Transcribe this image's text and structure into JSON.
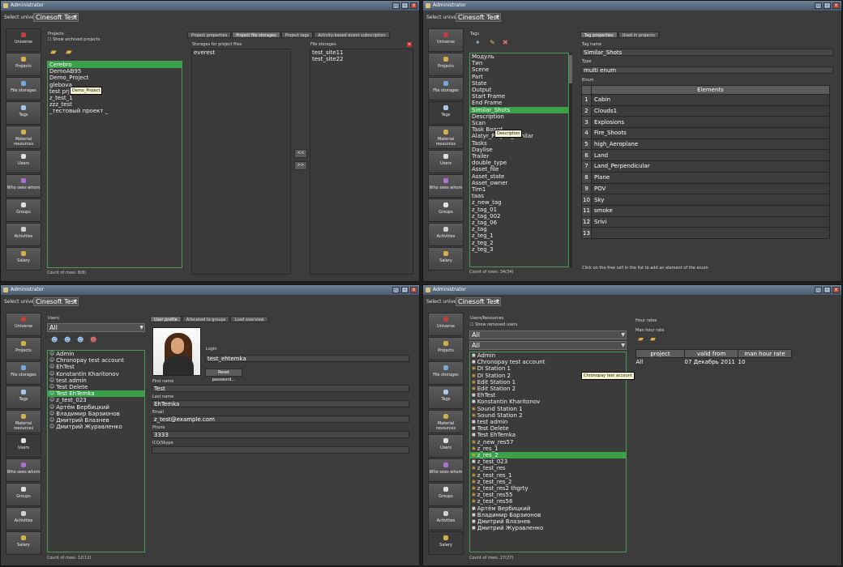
{
  "app": {
    "title": "Administrator"
  },
  "universe": {
    "label": "Select universe",
    "value": "Cinesoft Test"
  },
  "nav": [
    "Universe",
    "Projects",
    "File storages",
    "Tags",
    "Material resources",
    "Users",
    "Who sees whom",
    "Groups",
    "Activities",
    "Salary"
  ],
  "q1": {
    "projects_label": "Projects",
    "show_archived": "Show archived projects",
    "projects": [
      "Cerebro",
      "DemoAB95",
      "Demo_Project",
      "glebova",
      "test prj",
      "z_test_1",
      "zzz_test",
      "_тестовый проект _"
    ],
    "selected_index": 0,
    "tooltip": "Demo_Project",
    "count": "Count of rows: 8(8)",
    "tabs": [
      "Project properties",
      "Project file storages",
      "Project tags",
      "Activity-based event subscription"
    ],
    "storages_label": "Storages for project files",
    "project_storages": [
      "everest"
    ],
    "file_storages_label": "File storages",
    "file_storages": [
      "test_site11",
      "test_site22"
    ],
    "move_left": "<<",
    "move_right": ">>"
  },
  "q2": {
    "tags_label": "Tags",
    "tags": [
      "Модуль",
      "Тип",
      "Scene",
      "Part",
      "State",
      "Output",
      "Start Frame",
      "End Frame",
      "Similar_Shots",
      "Description",
      "Scan",
      "Task Board",
      "Alatyr_Project_Similar",
      "Tasks",
      "Daylise",
      "Trailer",
      "double_type",
      "Asset_file",
      "Asset_state",
      "Asset_owner",
      "Tim1",
      "taas",
      "z_new_tag",
      "z_tag_01",
      "z_tag_002",
      "z_tag_06",
      "z_tag",
      "z_teg_1",
      "z_teg_2",
      "z_teg_3"
    ],
    "selected_index": 8,
    "tooltip": "Description",
    "count": "Count of rows: 34(34)",
    "tabs": [
      "Tag properties",
      "Used in projects"
    ],
    "tag_name_label": "Tag name",
    "tag_name": "Similar_Shots",
    "type_label": "Type",
    "type_value": "multi enum",
    "enum_label": "Enum",
    "elements_header": "Elements",
    "elements": [
      "Cabin",
      "Clouds1",
      "Explosions",
      "Fire_Shoots",
      "high_Aeroplane",
      "Land",
      "Land_Perpendicular",
      "Plane",
      "POV",
      "Sky",
      "smoke",
      "Srivi",
      ""
    ],
    "hint": "Click on the free cell in the list to add an element of the enum"
  },
  "q3": {
    "users_label": "Users",
    "filter": "All",
    "users": [
      "Admin",
      "Chronopay test account",
      "EhTest",
      "Konstantin Kharitonov",
      "test admin",
      "Test Delete",
      "Test EhTemka",
      "z_test_023",
      "Артём Вербицкий",
      "Владимир Барзионов",
      "Дмитрий Влазнев",
      "Дмитрий Журавленко"
    ],
    "selected_index": 6,
    "count": "Count of rows: 12(12)",
    "tabs": [
      "User profile",
      "Allocated to groups",
      "Load overview"
    ],
    "login_label": "Login",
    "login": "test_ehtemka",
    "reset_password": "Reset password...",
    "first_name_label": "First name",
    "first_name": "Test",
    "last_name_label": "Last name",
    "last_name": "EhTemka",
    "email_label": "Email",
    "email": "z_test@example.com",
    "phone_label": "Phone",
    "phone": "3333",
    "icq_label": "ICQ/Skype",
    "icq": ""
  },
  "q4": {
    "users_label": "Users/Resources",
    "show_removed": "Show removed users",
    "filter1": "All",
    "filter2": "All",
    "users": [
      "Admin",
      "Chronopay test account",
      "DI Station 1",
      "DI Station 2",
      "Edit Station 1",
      "Edit Station 2",
      "EhTest",
      "Konstantin Kharitonov",
      "Sound Station 1",
      "Sound Station 2",
      "test admin",
      "Test Delete",
      "Test EhTemka",
      "z_new_res57",
      "z_res_1",
      "z_res_2",
      "z_test_023",
      "z_test_res",
      "z_test_res_1",
      "z_test_res_2",
      "z_test_res2 thgrty",
      "z_test_res55",
      "z_test_res56",
      "Артём Вербицкий",
      "Владимир Барзионов",
      "Дмитрий Влазнев",
      "Дмитрий Журавленко"
    ],
    "resource_indices": [
      2,
      3,
      4,
      5,
      8,
      9,
      13,
      14,
      15,
      17,
      18,
      19,
      20,
      21,
      22
    ],
    "selected_index": 15,
    "tooltip": "Chronopay test account",
    "count": "Count of rows: 27(27)",
    "rates_title": "Hour rates",
    "rates_sub": "Man hour rate",
    "rate_headers": [
      "project",
      "valid from",
      "man hour rate"
    ],
    "rate_rows": [
      [
        "All",
        "07 Декабрь 2011",
        "10"
      ]
    ]
  }
}
